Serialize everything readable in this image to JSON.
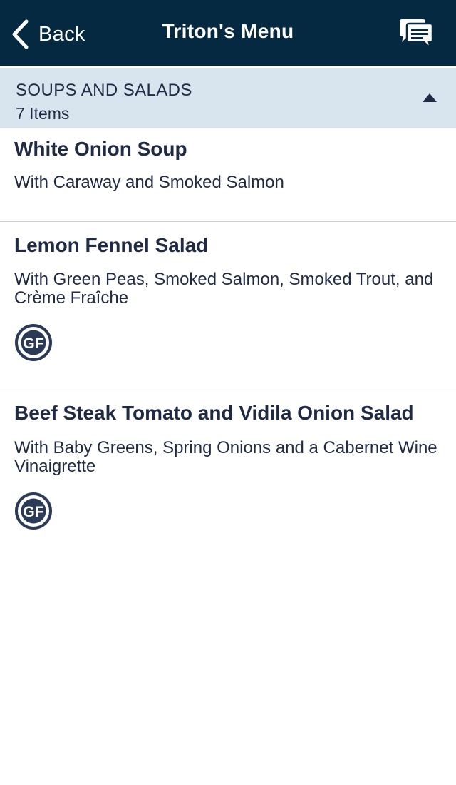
{
  "navbar": {
    "back_label": "Back",
    "title": "Triton's Menu",
    "back_icon": "chevron-left-icon",
    "chat_icon": "chat-bubbles-icon",
    "background": "#062942"
  },
  "section": {
    "title": "SOUPS AND SALADS",
    "count": "7 Items",
    "collapse_icon": "triangle-up-icon",
    "background": "#d8e5ee"
  },
  "items": [
    {
      "name": "White Onion Soup",
      "description": "With Caraway and Smoked Salmon"
    },
    {
      "name": "Lemon Fennel Salad",
      "description": "With Green Peas, Smoked Salmon, Smoked Trout, and Crème Fraîche",
      "badge": "GF"
    },
    {
      "name": "Beef Steak Tomato and Vidila Onion Salad",
      "description": "With Baby Greens, Spring Onions and a Cabernet Wine Vinaigrette",
      "badge": "GF"
    }
  ],
  "colors": {
    "text": "#1f2a44",
    "badge": "#2b3a57",
    "divider": "#cfcfcf"
  }
}
